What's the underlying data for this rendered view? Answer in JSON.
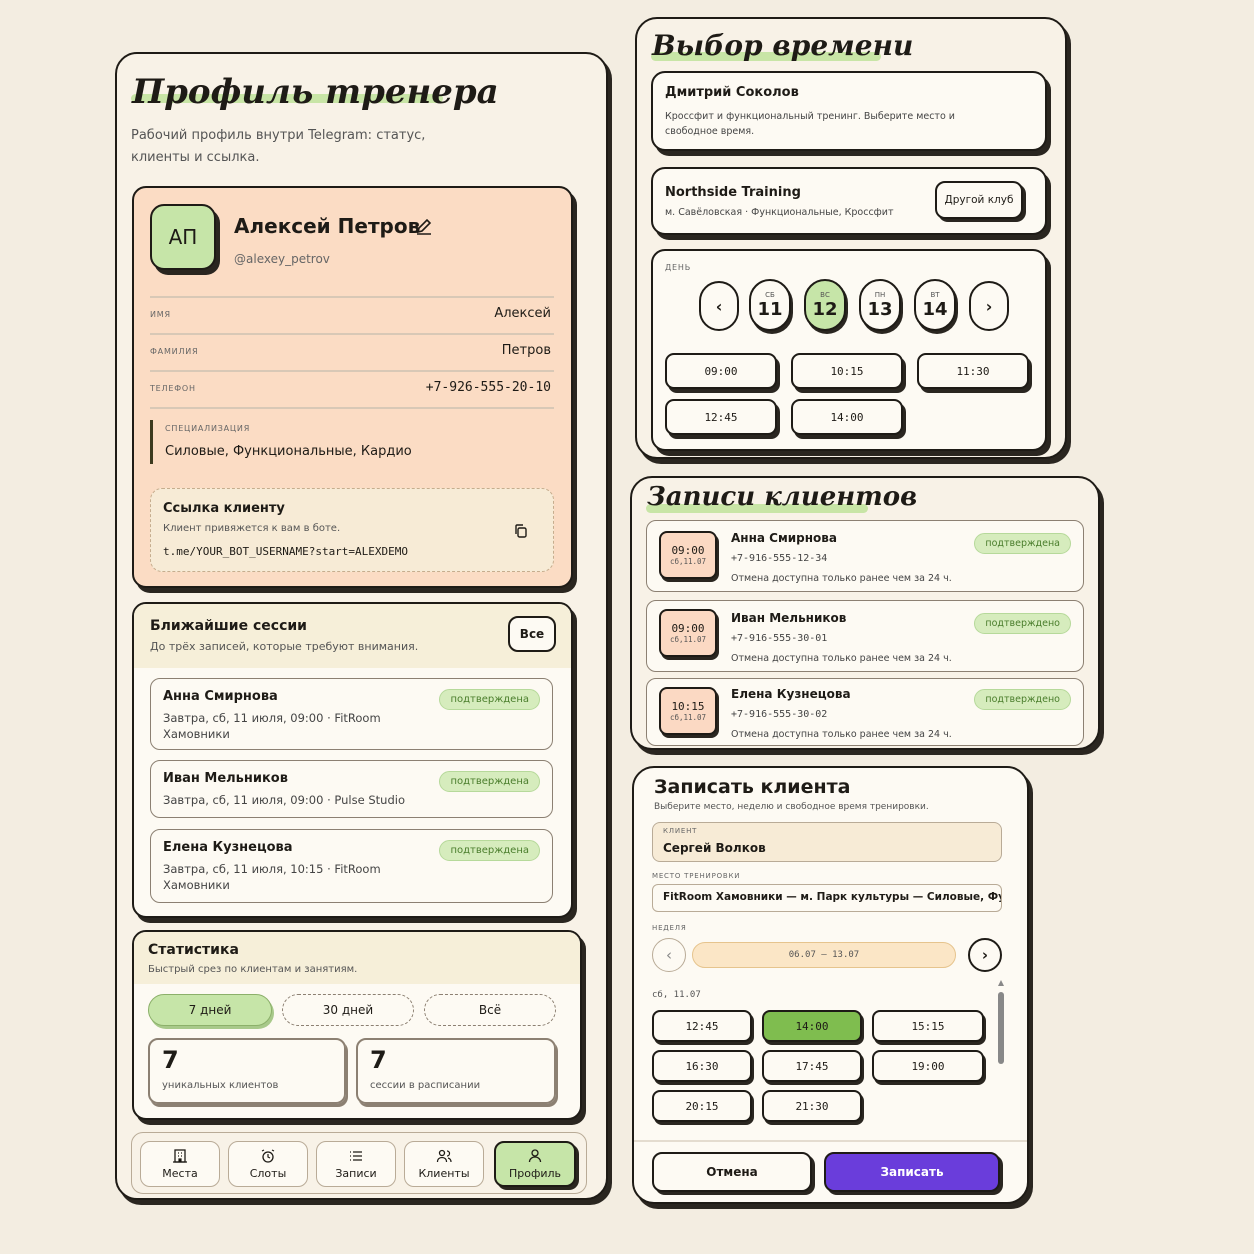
{
  "profile": {
    "title": "Профиль тренера",
    "subtitle_1": "Рабочий профиль внутри Telegram: статус,",
    "subtitle_2": "клиенты и ссылка.",
    "avatar_initials": "АП",
    "name": "Алексей Петров",
    "username": "@alexey_petrov",
    "fields": [
      {
        "label": "ИМЯ",
        "value": "Алексей"
      },
      {
        "label": "ФАМИЛИЯ",
        "value": "Петров"
      },
      {
        "label": "ТЕЛЕФОН",
        "value": "+7-926-555-20-10"
      }
    ],
    "specialization_label": "СПЕЦИАЛИЗАЦИЯ",
    "specialization": "Силовые, Функциональные, Кардио",
    "link_title": "Ссылка клиенту",
    "link_desc": "Клиент привяжется к вам в боте.",
    "link_url": "t.me/YOUR_BOT_USERNAME?start=ALEXDEMO"
  },
  "sessions": {
    "title": "Ближайшие сессии",
    "subtitle": "До трёх записей, которые требуют внимания.",
    "all_button": "Все",
    "items": [
      {
        "name": "Анна Смирнова",
        "line1": "Завтра, сб, 11 июля, 09:00 · FitRoom",
        "line2": "Хамовники",
        "status": "подтверждена"
      },
      {
        "name": "Иван Мельников",
        "line1": "Завтра, сб, 11 июля, 09:00 · Pulse Studio",
        "line2": "",
        "status": "подтверждена"
      },
      {
        "name": "Елена Кузнецова",
        "line1": "Завтра, сб, 11 июля, 10:15 · FitRoom",
        "line2": "Хамовники",
        "status": "подтверждена"
      }
    ]
  },
  "stats": {
    "title": "Статистика",
    "subtitle": "Быстрый срез по клиентам и занятиям.",
    "periods": [
      "7 дней",
      "30 дней",
      "Всё"
    ],
    "active_period": 0,
    "clients_value": "7",
    "clients_label": "уникальных клиентов",
    "sessions_value": "7",
    "sessions_label": "сессии в расписании"
  },
  "bottom_nav": [
    {
      "label": "Места",
      "icon": "building-icon"
    },
    {
      "label": "Слоты",
      "icon": "alarm-clock-icon"
    },
    {
      "label": "Записи",
      "icon": "list-icon"
    },
    {
      "label": "Клиенты",
      "icon": "users-icon"
    },
    {
      "label": "Профиль",
      "icon": "user-icon"
    }
  ],
  "time_choice": {
    "title": "Выбор времени",
    "trainer_name": "Дмитрий Соколов",
    "trainer_desc_1": "Кроссфит и функциональный тренинг. Выберите место и",
    "trainer_desc_2": "свободное время.",
    "club_name": "Northside Training",
    "club_desc": "м. Савёловская · Функциональные, Кроссфит",
    "other_club": "Другой клуб",
    "day_label": "ДЕНЬ",
    "days": [
      {
        "dow": "СБ",
        "num": "11"
      },
      {
        "dow": "ВС",
        "num": "12"
      },
      {
        "dow": "ПН",
        "num": "13"
      },
      {
        "dow": "ВТ",
        "num": "14"
      }
    ],
    "selected_day": 1,
    "slots": [
      "09:00",
      "10:15",
      "11:30",
      "12:45",
      "14:00"
    ]
  },
  "bookings": {
    "title": "Записи клиентов",
    "items": [
      {
        "time": "09:00",
        "date": "сб,11.07",
        "name": "Анна Смирнова",
        "phone": "+7-916-555-12-34",
        "note": "Отмена доступна только ранее чем за 24 ч.",
        "status": "подтверждена"
      },
      {
        "time": "09:00",
        "date": "сб,11.07",
        "name": "Иван Мельников",
        "phone": "+7-916-555-30-01",
        "note": "Отмена доступна только ранее чем за 24 ч.",
        "status": "подтверждено"
      },
      {
        "time": "10:15",
        "date": "сб,11.07",
        "name": "Елена Кузнецова",
        "phone": "+7-916-555-30-02",
        "note": "Отмена доступна только ранее чем за 24 ч.",
        "status": "подтверждено"
      }
    ]
  },
  "book_client": {
    "title": "Записать клиента",
    "subtitle": "Выберите место, неделю и свободное время тренировки.",
    "client_label": "КЛИЕНТ",
    "client_value": "Сергей Волков",
    "place_label": "МЕСТО ТРЕНИРОВКИ",
    "place_value": "FitRoom Хамовники — м. Парк культуры — Силовые, Функц",
    "week_label": "НЕДЕЛЯ",
    "week_value": "06.07 – 13.07",
    "date_label": "сб, 11.07",
    "slots": [
      "12:45",
      "14:00",
      "15:15",
      "16:30",
      "17:45",
      "19:00",
      "20:15",
      "21:30"
    ],
    "selected_slot": 1,
    "cancel": "Отмена",
    "submit": "Записать",
    "accent": "#6a3ddb"
  },
  "colors": {
    "profile_card": "#fbdcc4",
    "green": "#c6e5a8",
    "selected_slot": "#7fbd4f",
    "dark": "#1e1b16"
  }
}
